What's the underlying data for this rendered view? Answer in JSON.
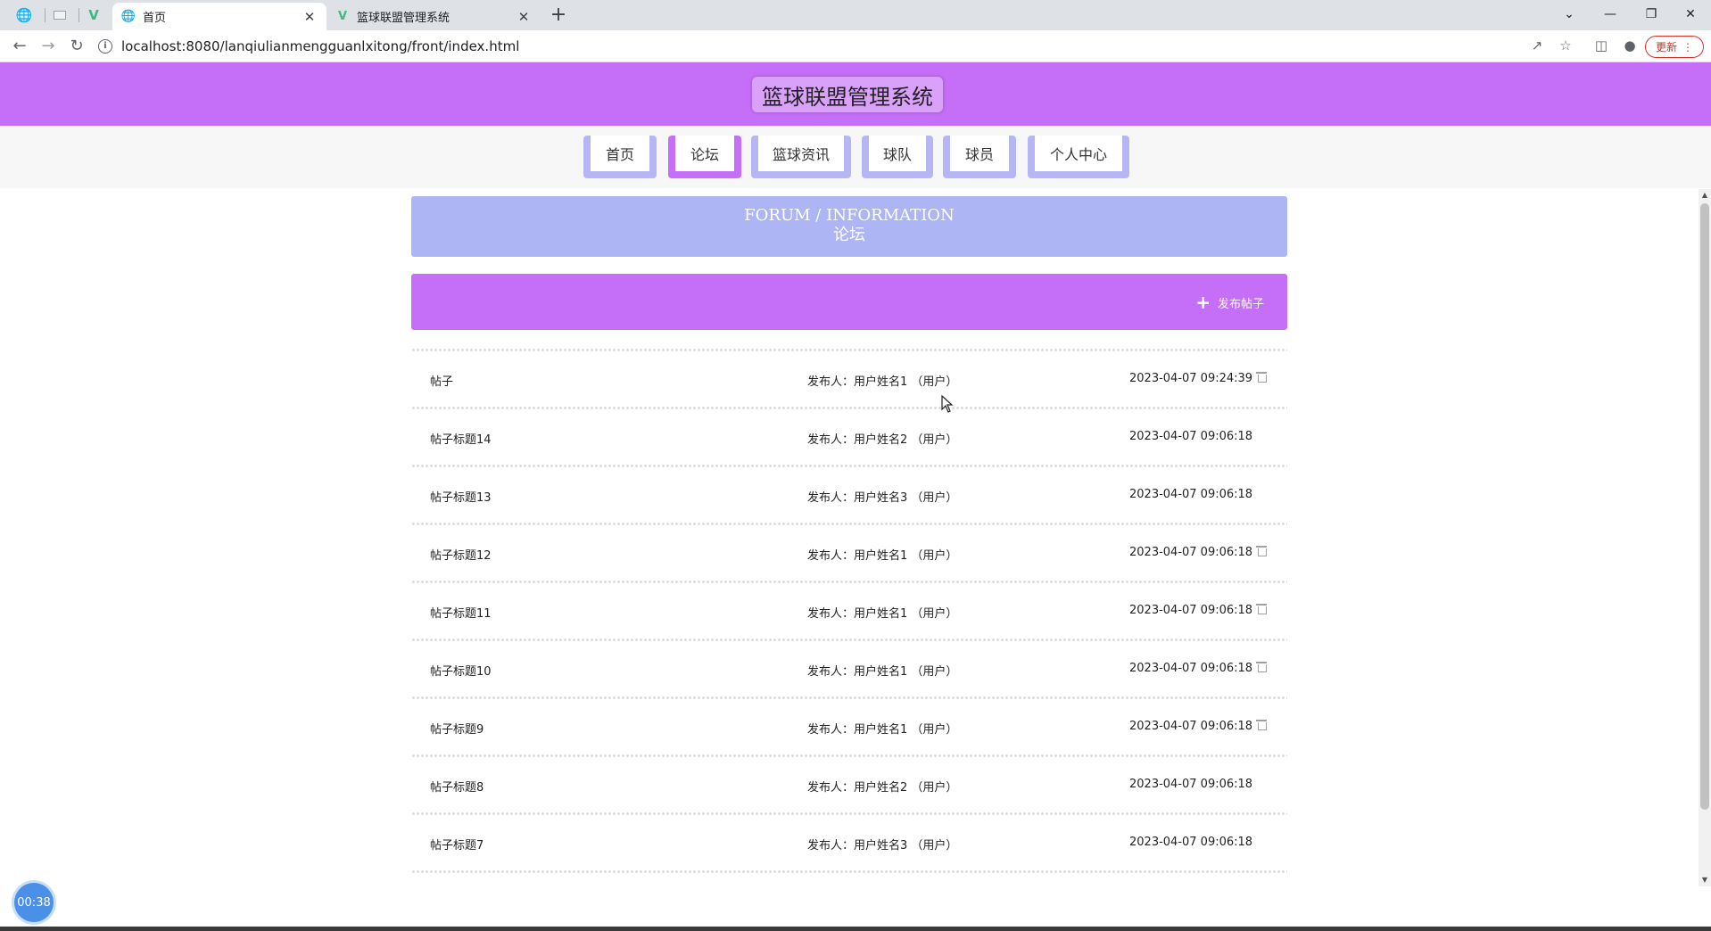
{
  "browser": {
    "tabs": [
      {
        "title": "首页",
        "active": true
      },
      {
        "title": "篮球联盟管理系统",
        "active": false
      }
    ],
    "url": "localhost:8080/lanqiulianmengguanlxitong/front/index.html",
    "update_label": "更新"
  },
  "site": {
    "title": "篮球联盟管理系统",
    "nav": [
      {
        "label": "首页",
        "active": false
      },
      {
        "label": "论坛",
        "active": true
      },
      {
        "label": "篮球资讯",
        "active": false
      },
      {
        "label": "球队",
        "active": false
      },
      {
        "label": "球员",
        "active": false
      },
      {
        "label": "个人中心",
        "active": false
      }
    ]
  },
  "forum": {
    "banner_en": "FORUM / INFORMATION",
    "banner_cn": "论坛",
    "post_button": "发布帖子",
    "posts": [
      {
        "title": "帖子",
        "author": "发布人：用户姓名1 （用户）",
        "date": "2023-04-07 09:24:39",
        "deletable": true
      },
      {
        "title": "帖子标题14",
        "author": "发布人：用户姓名2 （用户）",
        "date": "2023-04-07 09:06:18",
        "deletable": false
      },
      {
        "title": "帖子标题13",
        "author": "发布人：用户姓名3 （用户）",
        "date": "2023-04-07 09:06:18",
        "deletable": false
      },
      {
        "title": "帖子标题12",
        "author": "发布人：用户姓名1 （用户）",
        "date": "2023-04-07 09:06:18",
        "deletable": true
      },
      {
        "title": "帖子标题11",
        "author": "发布人：用户姓名1 （用户）",
        "date": "2023-04-07 09:06:18",
        "deletable": true
      },
      {
        "title": "帖子标题10",
        "author": "发布人：用户姓名1 （用户）",
        "date": "2023-04-07 09:06:18",
        "deletable": true
      },
      {
        "title": "帖子标题9",
        "author": "发布人：用户姓名1 （用户）",
        "date": "2023-04-07 09:06:18",
        "deletable": true
      },
      {
        "title": "帖子标题8",
        "author": "发布人：用户姓名2 （用户）",
        "date": "2023-04-07 09:06:18",
        "deletable": false
      },
      {
        "title": "帖子标题7",
        "author": "发布人：用户姓名3 （用户）",
        "date": "2023-04-07 09:06:18",
        "deletable": false
      }
    ]
  },
  "timer": "00:38",
  "colors": {
    "header": "#c56ff8",
    "nav_inactive": "#b6b6f5",
    "banner": "#adb5f4"
  }
}
